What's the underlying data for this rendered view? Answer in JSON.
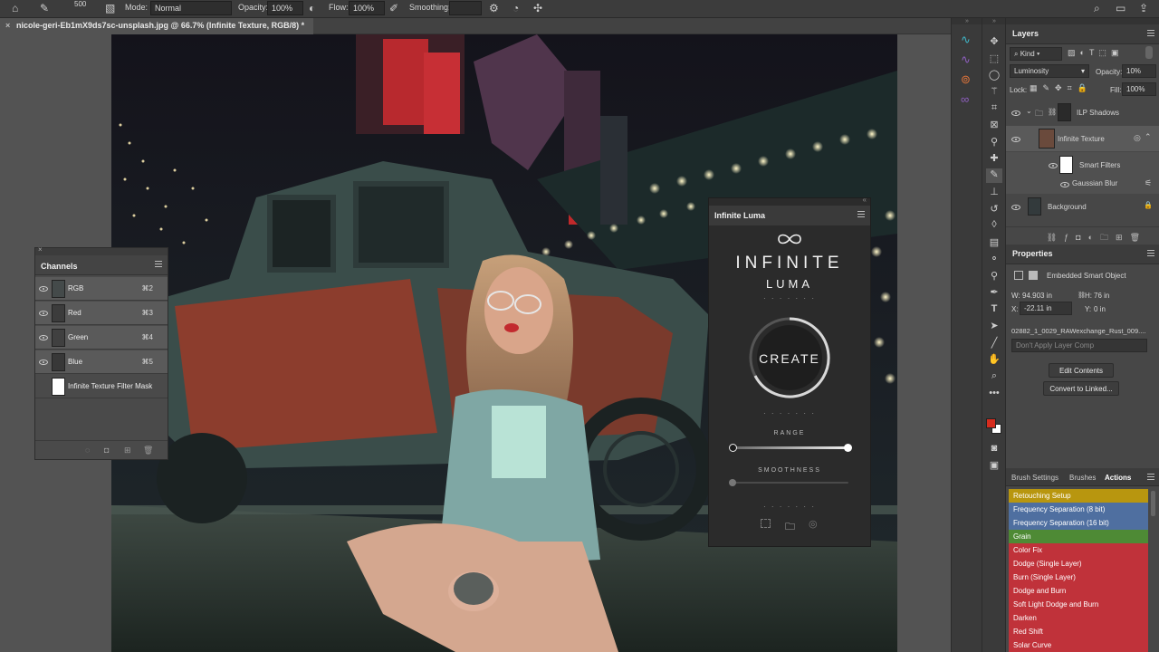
{
  "options_bar": {
    "brush_size": "500",
    "mode_label": "Mode:",
    "mode_value": "Normal",
    "opacity_label": "Opacity:",
    "opacity_value": "100%",
    "flow_label": "Flow:",
    "flow_value": "100%",
    "smoothing_label": "Smoothing:"
  },
  "document": {
    "tab_title": "nicole-geri-Eb1mX9ds7sc-unsplash.jpg @ 66.7% (Infinite Texture, RGB/8) *"
  },
  "channels_panel": {
    "title": "Channels",
    "rows": [
      {
        "name": "RGB",
        "shortcut": "⌘2"
      },
      {
        "name": "Red",
        "shortcut": "⌘3"
      },
      {
        "name": "Green",
        "shortcut": "⌘4"
      },
      {
        "name": "Blue",
        "shortcut": "⌘5"
      },
      {
        "name": "Infinite Texture Filter Mask",
        "shortcut": ""
      }
    ]
  },
  "luma_panel": {
    "title": "Infinite Luma",
    "brand_line1": "INFINITE",
    "brand_line2": "LUMA",
    "create_label": "CREATE",
    "range_label": "RANGE",
    "smoothness_label": "SMOOTHNESS",
    "range_min": 0,
    "range_max": 1,
    "smoothness_value": 0
  },
  "layers_panel": {
    "title": "Layers",
    "filter_kind": "Kind",
    "blend_mode": "Luminosity",
    "opacity_label": "Opacity:",
    "opacity_value": "10%",
    "lock_label": "Lock:",
    "fill_label": "Fill:",
    "fill_value": "100%",
    "layers": [
      {
        "name": "ILP Shadows"
      },
      {
        "name": "Infinite Texture"
      },
      {
        "name": "Smart Filters"
      },
      {
        "name": "Gaussian Blur"
      },
      {
        "name": "Background"
      }
    ]
  },
  "properties_panel": {
    "title": "Properties",
    "kind": "Embedded Smart Object",
    "w_label": "W:",
    "w_value": "94.903 in",
    "h_label": "H:",
    "h_value": "76 in",
    "x_label": "X:",
    "x_value": "-22.11 in",
    "y_label": "Y:",
    "y_value": "0 in",
    "source_file": "02882_1_0029_RAWexchange_Rust_009....",
    "layer_comp": "Don't Apply Layer Comp",
    "edit_contents": "Edit Contents",
    "convert_linked": "Convert to Linked..."
  },
  "actions_panel": {
    "tabs": [
      "Brush Settings",
      "Brushes",
      "Actions"
    ],
    "active_tab": "Actions",
    "items": [
      {
        "label": "Retouching Setup",
        "color": "#b8960f"
      },
      {
        "label": "Frequency Separation (8 bit)",
        "color": "#4f6fa0"
      },
      {
        "label": "Frequency Separation (16 bit)",
        "color": "#4f6fa0"
      },
      {
        "label": "Grain",
        "color": "#4e8a35"
      },
      {
        "label": "Color Fix",
        "color": "#c0323a"
      },
      {
        "label": "Dodge (Single Layer)",
        "color": "#c0323a"
      },
      {
        "label": "Burn (Single Layer)",
        "color": "#c0323a"
      },
      {
        "label": "Dodge and Burn",
        "color": "#c0323a"
      },
      {
        "label": "Soft Light Dodge and Burn",
        "color": "#c0323a"
      },
      {
        "label": "Darken",
        "color": "#c0323a"
      },
      {
        "label": "Red Shift",
        "color": "#c0323a"
      },
      {
        "label": "Solar Curve",
        "color": "#c0323a"
      }
    ]
  },
  "colors": {
    "foreground": "#d62c1e",
    "background": "#ffffff"
  }
}
